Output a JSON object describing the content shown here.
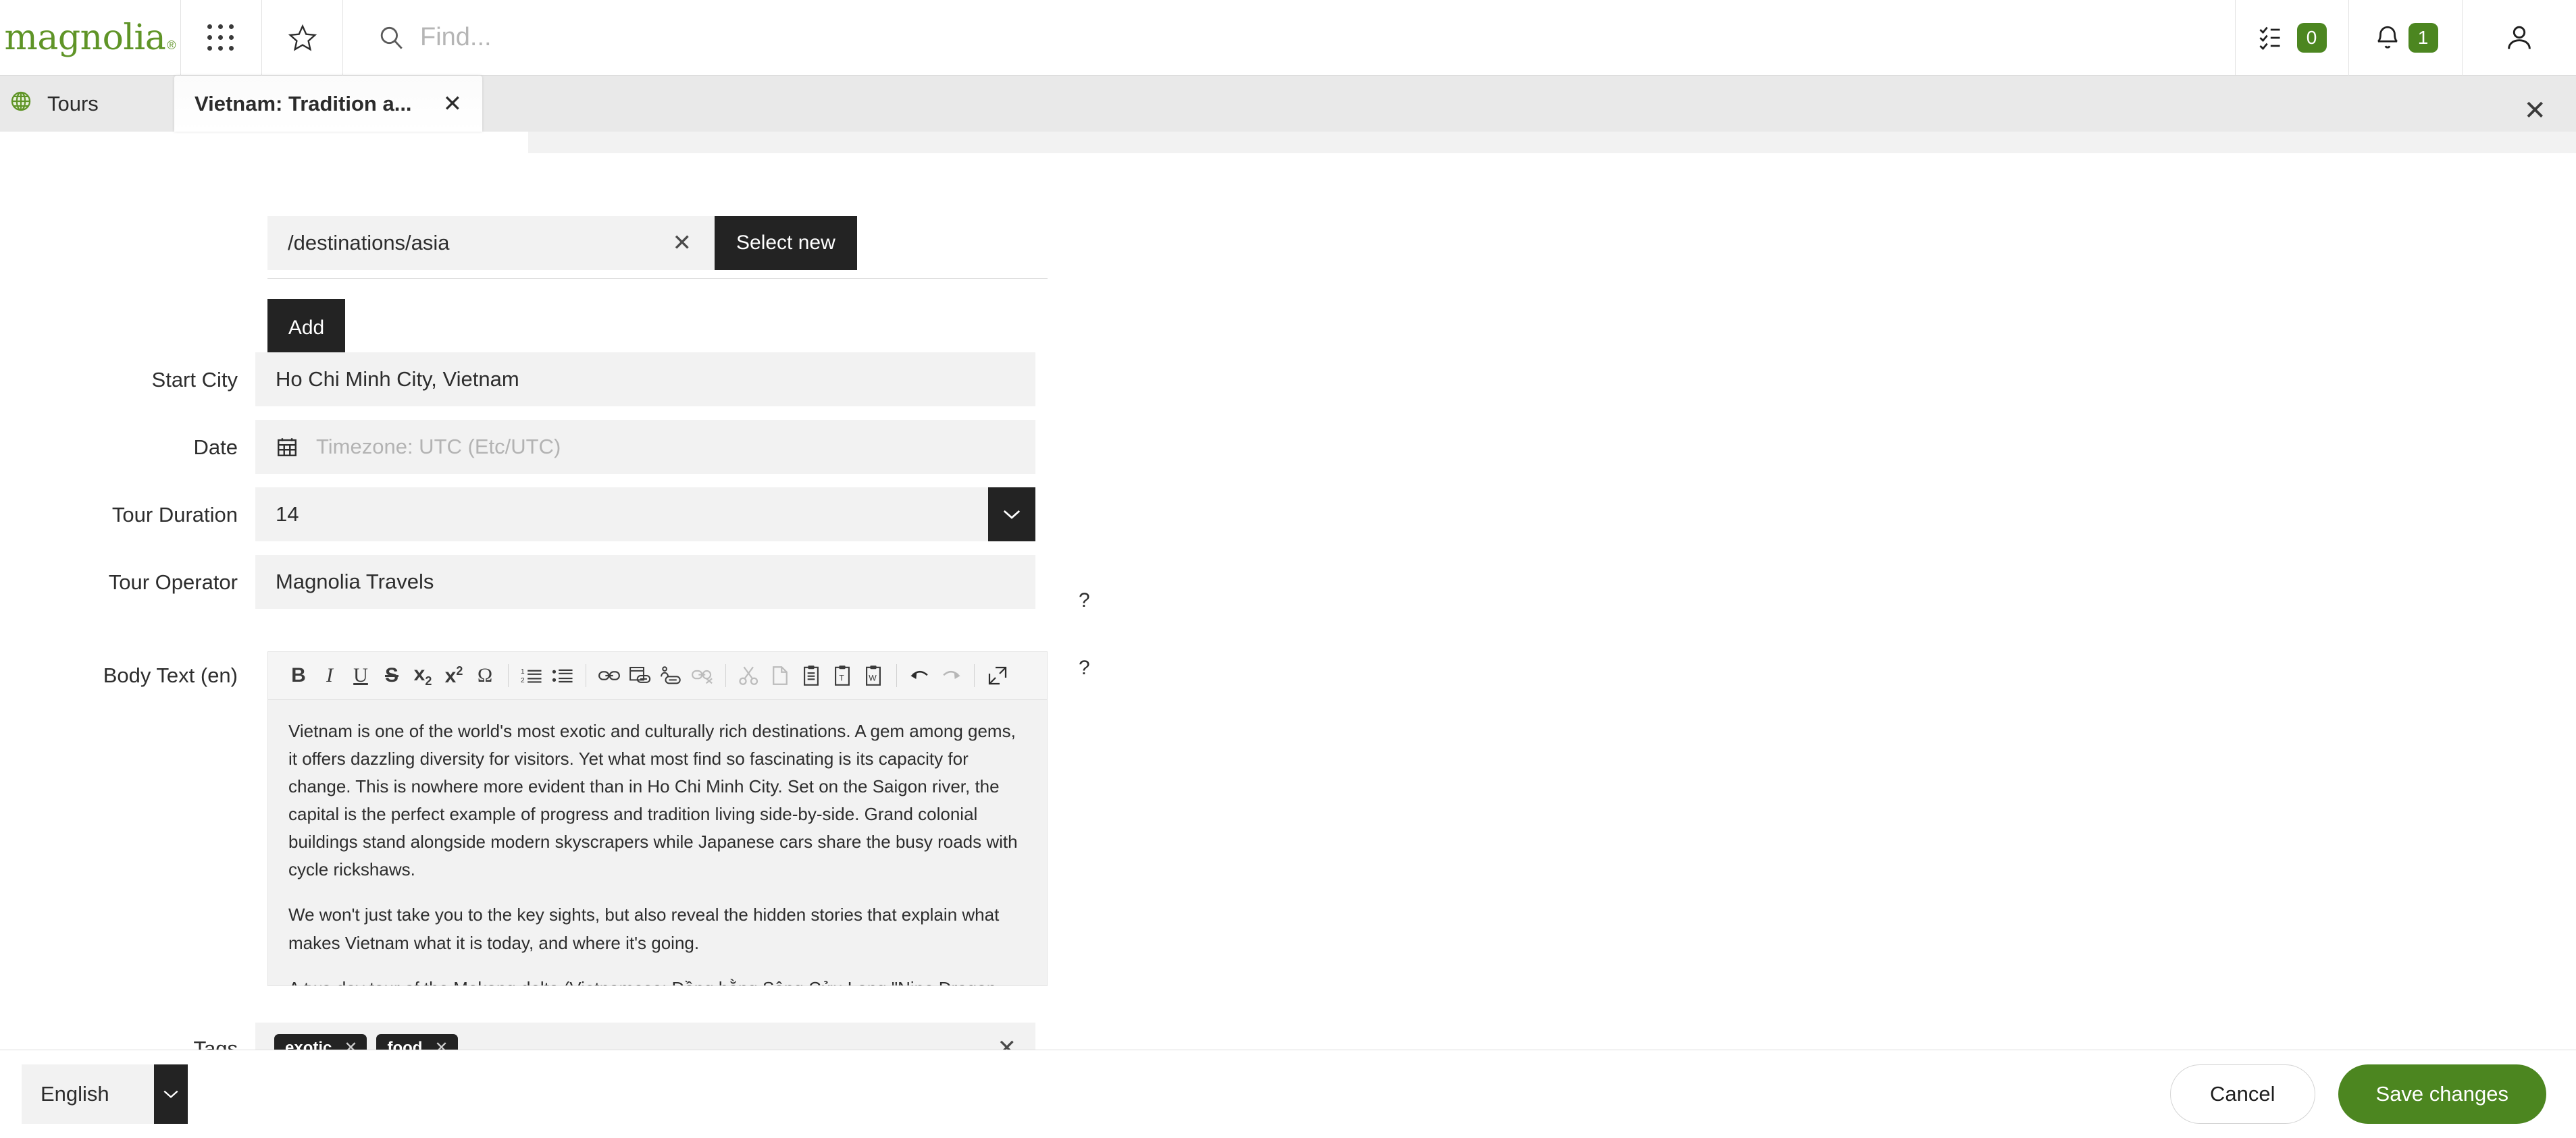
{
  "header": {
    "logo_text": "magnolia",
    "logo_mark": "®",
    "apps_icon": "apps-grid-icon",
    "favorites_icon": "star-icon",
    "search": {
      "icon": "search-icon",
      "placeholder": "Find...",
      "value": ""
    },
    "tasks": {
      "icon": "tasks-checklist-icon",
      "badge": "0"
    },
    "notifications": {
      "icon": "bell-icon",
      "badge": "1"
    },
    "user": {
      "icon": "user-avatar-icon"
    },
    "accent_green": "#4c8620"
  },
  "tabs": [
    {
      "label": "Tours",
      "icon": "globe-icon",
      "active": false,
      "closable": false
    },
    {
      "label": "Vietnam: Tradition a...",
      "icon": "",
      "active": true,
      "closable": true,
      "close_glyph": "✕"
    }
  ],
  "dialog": {
    "close_glyph": "✕"
  },
  "form": {
    "link_field": {
      "value": "/destinations/asia",
      "clear_glyph": "✕",
      "select_new_label": "Select new"
    },
    "add_label": "Add",
    "fields": [
      {
        "label": "Start City",
        "value": "Ho Chi Minh City, Vietnam",
        "type": "text"
      },
      {
        "label": "Date",
        "value": "",
        "placeholder": "Timezone: UTC (Etc/UTC)",
        "type": "date",
        "icon": "calendar-icon"
      },
      {
        "label": "Tour Duration",
        "value": "14",
        "type": "select",
        "arrow_glyph": "⌄"
      },
      {
        "label": "Tour Operator",
        "value": "Magnolia Travels",
        "type": "text",
        "help": "?"
      },
      {
        "label": "Body Text (en)",
        "type": "richtext",
        "help": "?"
      },
      {
        "label": "Tags",
        "type": "tags"
      }
    ],
    "richtext": {
      "toolbar": [
        {
          "name": "bold-icon",
          "glyph": "B",
          "style": "bold"
        },
        {
          "name": "italic-icon",
          "glyph": "I",
          "style": "italic"
        },
        {
          "name": "underline-icon",
          "glyph": "U",
          "style": "underline"
        },
        {
          "name": "strikethrough-icon",
          "glyph": "S",
          "style": "strike"
        },
        {
          "name": "subscript-icon",
          "glyph": "x₂",
          "style": "plain"
        },
        {
          "name": "superscript-icon",
          "glyph": "x²",
          "style": "plain"
        },
        {
          "name": "special-character-icon",
          "glyph": "Ω",
          "style": "plain"
        },
        {
          "name": "separator",
          "glyph": "",
          "style": "sep"
        },
        {
          "name": "numbered-list-icon",
          "glyph": "",
          "style": "svg-ol"
        },
        {
          "name": "bulleted-list-icon",
          "glyph": "",
          "style": "svg-ul"
        },
        {
          "name": "separator",
          "glyph": "",
          "style": "sep"
        },
        {
          "name": "link-icon",
          "glyph": "",
          "style": "svg-link"
        },
        {
          "name": "internal-link-icon",
          "glyph": "",
          "style": "svg-page-link"
        },
        {
          "name": "anchor-link-icon",
          "glyph": "",
          "style": "svg-anchor"
        },
        {
          "name": "unlink-icon",
          "glyph": "",
          "style": "svg-unlink",
          "disabled": true
        },
        {
          "name": "separator",
          "glyph": "",
          "style": "sep"
        },
        {
          "name": "cut-icon",
          "glyph": "✂",
          "style": "plain",
          "disabled": true
        },
        {
          "name": "copy-icon",
          "glyph": "",
          "style": "svg-copy",
          "disabled": true
        },
        {
          "name": "paste-icon",
          "glyph": "",
          "style": "svg-paste"
        },
        {
          "name": "paste-as-text-icon",
          "glyph": "",
          "style": "svg-paste-text"
        },
        {
          "name": "paste-from-word-icon",
          "glyph": "",
          "style": "svg-paste-word"
        },
        {
          "name": "separator",
          "glyph": "",
          "style": "sep"
        },
        {
          "name": "undo-icon",
          "glyph": "",
          "style": "svg-undo"
        },
        {
          "name": "redo-icon",
          "glyph": "",
          "style": "svg-redo",
          "disabled": true
        },
        {
          "name": "separator",
          "glyph": "",
          "style": "sep"
        },
        {
          "name": "fullscreen-icon",
          "glyph": "",
          "style": "svg-fullscreen"
        }
      ],
      "paragraphs": [
        "Vietnam is one of the world's most exotic and culturally rich destinations. A gem among gems, it offers dazzling diversity for visitors. Yet what most find so fascinating is its capacity for change. This is nowhere more evident than in Ho Chi Minh City. Set on the Saigon river, the capital is the perfect example of progress and tradition living side-by-side. Grand colonial buildings stand alongside modern skyscrapers while Japanese cars share the busy roads with cycle rickshaws.",
        "We won't just take you to the key sights, but also reveal the hidden stories that explain what makes Vietnam what it is today, and where it's going.",
        "A two day tour of the Mekong delta (Vietnamese: Đồng bằng Sông Cửu Long \"Nine Dragon river delta\") will immerse you in a water-world maze where everything happens on the boats - even local markets which form every day from a raft of vendors boats. We'll continue to the coastal town of Vung Tau in the"
      ]
    },
    "tags": {
      "chips": [
        {
          "label": "exotic",
          "remove_glyph": "✕"
        },
        {
          "label": "food",
          "remove_glyph": "✕"
        }
      ],
      "clear_glyph": "✕"
    }
  },
  "footer": {
    "language": {
      "value": "English",
      "arrow_glyph": "⌄"
    },
    "cancel_label": "Cancel",
    "save_label": "Save changes"
  }
}
